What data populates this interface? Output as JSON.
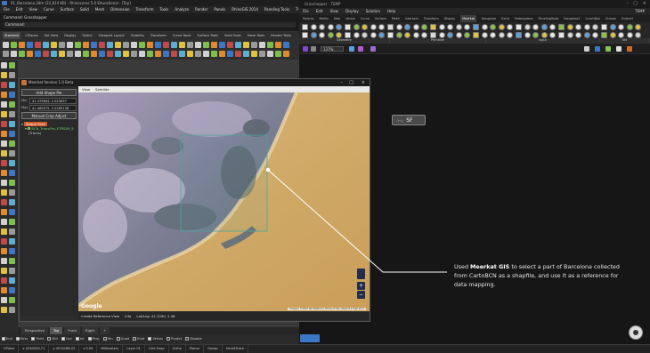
{
  "rhino": {
    "title": "01_Barcelona.3dm (22,814 KB) - Rhinoceros 5.0 Educational - [Top]",
    "menu": [
      "File",
      "Edit",
      "View",
      "Curve",
      "Surface",
      "Solid",
      "Mesh",
      "Dimension",
      "Transform",
      "Tools",
      "Analyze",
      "Render",
      "Panels",
      "RhinoGIS 2014",
      "Paneling Tools",
      "T-Splines"
    ],
    "command_history": "Command: Grasshopper",
    "command_prompt": "Command:",
    "toolbar_tabs": [
      "Standard",
      "CPlanes",
      "Set View",
      "Display",
      "Select",
      "Viewport Layout",
      "Visibility",
      "Transform",
      "Curve Tools",
      "Surface Tools",
      "Solid Tools",
      "Mesh Tools",
      "Render Tools"
    ],
    "viewport_tabs": [
      "Perspective",
      "Top",
      "Front",
      "Right"
    ],
    "viewport_active": "Top",
    "osnaps": [
      {
        "label": "End",
        "on": true
      },
      {
        "label": "Near",
        "on": true
      },
      {
        "label": "Point",
        "on": true
      },
      {
        "label": "Mid",
        "on": false
      },
      {
        "label": "Cen",
        "on": true
      },
      {
        "label": "Int",
        "on": true
      },
      {
        "label": "Perp",
        "on": true
      },
      {
        "label": "Tan",
        "on": false
      },
      {
        "label": "Quad",
        "on": false
      },
      {
        "label": "Knot",
        "on": false
      },
      {
        "label": "Vertex",
        "on": true
      },
      {
        "label": "Project",
        "on": false
      },
      {
        "label": "Disable",
        "on": false
      }
    ],
    "status": [
      "CPlane",
      "x 4230529.71",
      "y 4574188.25",
      "z 0.00",
      "Millimeters",
      "Layer 01",
      "Grid Snap",
      "Ortho",
      "Planar",
      "Osnap",
      "SmartTrack"
    ]
  },
  "grasshopper": {
    "title": "Grasshopper - TEMP",
    "menu": [
      "File",
      "Edit",
      "View",
      "Display",
      "Solution",
      "Help"
    ],
    "menu_right": "TEMP",
    "tabs": [
      "Params",
      "Maths",
      "Sets",
      "Vector",
      "Curve",
      "Surface",
      "Mesh",
      "Intersect",
      "Transform",
      "Display",
      "Meerkat",
      "Kangaroo",
      "Extra",
      "Heteroptera",
      "PanelingTools",
      "Kangaroo2",
      "LunchBox",
      "Human",
      "Ecotect"
    ],
    "active_tab": "Meerkat",
    "groups": [
      "Geometry",
      "Primitive",
      "Input",
      "Util"
    ],
    "zoom": "137%",
    "component_label": "SF"
  },
  "meerkat": {
    "title": "Meerkat Version 1.0 Beta",
    "add_button": "Add Shape file",
    "min_label": "Min",
    "min_value": "41.379654, 2.023097",
    "max_label": "Max",
    "max_value": "41.465072, 2.2285138",
    "manual_button": "Manual Crop Adjust",
    "tree_root": "Shape Files",
    "tree_child": "BCN_TransiPol_ETRS89_5",
    "tree_grandchild": "(Trams)",
    "map_menu": [
      "View",
      "Satellite"
    ],
    "footer_button": "Create Reference View",
    "footer_info": "Info",
    "footer_coords": "Lat/Lng: 41.3290, 2.48",
    "google": "Google",
    "attribution": "Imagery ©2015 TerraMetrics  |  Terms of Use  |  Report a map error"
  },
  "annotation": {
    "prefix": "Used ",
    "bold": "Meerkat GIS",
    "suffix": " to select a part of Barcelona collected from CartoBCN as a shapfile, and use it as a reference for data mapping."
  }
}
